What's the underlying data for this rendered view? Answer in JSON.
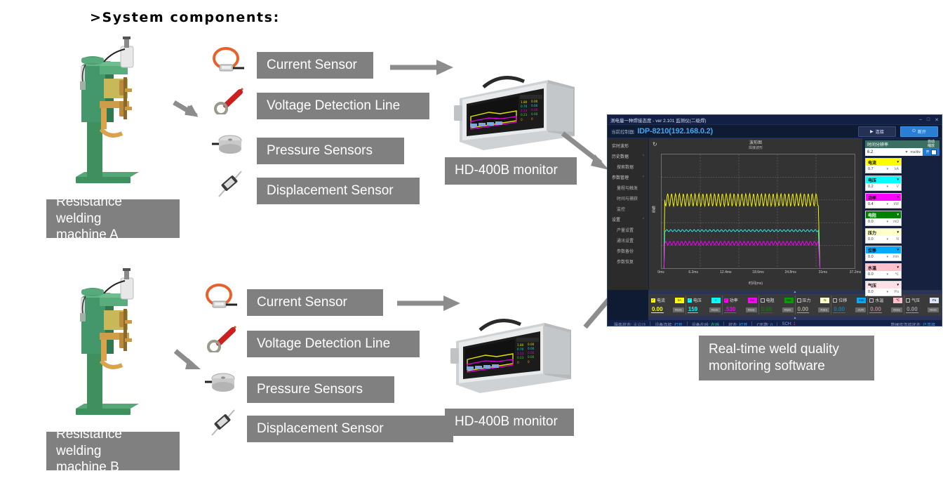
{
  "heading": ">System components:",
  "groups": [
    {
      "machine_label": "Resistance welding\nmachine A",
      "sensors": [
        {
          "label": "Current Sensor",
          "icon": "current-sensor-icon"
        },
        {
          "label": "Voltage Detection Line",
          "icon": "voltage-detection-line-icon"
        },
        {
          "label": "Pressure Sensors",
          "icon": "pressure-sensor-icon"
        },
        {
          "label": "Displacement Sensor",
          "icon": "displacement-sensor-icon"
        }
      ],
      "monitor_label": "HD-400B monitor"
    },
    {
      "machine_label": "Resistance welding\nmachine B",
      "sensors": [
        {
          "label": "Current Sensor",
          "icon": "current-sensor-icon"
        },
        {
          "label": "Voltage Detection Line",
          "icon": "voltage-detection-line-icon"
        },
        {
          "label": "Pressure Sensors",
          "icon": "pressure-sensor-icon"
        },
        {
          "label": "Displacement Sensor",
          "icon": "displacement-sensor-icon"
        }
      ],
      "monitor_label": "HD-400B monitor"
    }
  ],
  "software_caption": "Real-time weld quality\nmonitoring software",
  "software": {
    "title": "测电量一种焊接态度 - ver 2.101 监测仪(二级焊)",
    "window_buttons": [
      "–",
      "□",
      "✕"
    ],
    "controller_label": "当前控制器:",
    "controller_value": "IDP-8210(192.168.0.2)",
    "connect_button": "连接",
    "disconnect_button": "断开",
    "sidebar": [
      {
        "label": "实时波形",
        "sub": false,
        "caret": ""
      },
      {
        "label": "历史数据",
        "sub": false,
        "caret": "⌃"
      },
      {
        "label": "搜索数据",
        "sub": true,
        "caret": ""
      },
      {
        "label": "参数管理",
        "sub": false,
        "caret": "⌃"
      },
      {
        "label": "量程与触发",
        "sub": true,
        "caret": ""
      },
      {
        "label": "时间与捕获",
        "sub": true,
        "caret": ""
      },
      {
        "label": "监控",
        "sub": true,
        "caret": ""
      },
      {
        "label": "设置",
        "sub": false,
        "caret": "⌃"
      },
      {
        "label": "产量设置",
        "sub": true,
        "caret": ""
      },
      {
        "label": "通讯设置",
        "sub": true,
        "caret": ""
      },
      {
        "label": "参数备份",
        "sub": true,
        "caret": ""
      },
      {
        "label": "参数恢复",
        "sub": true,
        "caret": ""
      }
    ],
    "chart_title": "波形图",
    "chart_subtitle": "焊接波形",
    "refresh_icon": "refresh-icon",
    "y_axis_label": "幅值",
    "x_axis_label": "时间(ms)",
    "param_panel": {
      "header_label": "时间分辨率",
      "header_right": "自动\n缩放",
      "value": "6.2",
      "unit": "ms/div",
      "toggle_label": "开",
      "cells": [
        {
          "name": "电流",
          "head_bg": "#ffff00",
          "head_fg": "#000000",
          "value": "0.0",
          "unit": "kA",
          "value_shown": "0.7"
        },
        {
          "name": "电压",
          "head_bg": "#00ffff",
          "head_fg": "#000000",
          "value": "0.2",
          "unit": "V",
          "value_shown": "0.2"
        },
        {
          "name": "功率",
          "head_bg": "#ff00ff",
          "head_fg": "#000000",
          "value": "0.4",
          "unit": "kW",
          "value_shown": "0.4"
        },
        {
          "name": "电阻",
          "head_bg": "#008000",
          "head_fg": "#ffffff",
          "value": "0.0",
          "unit": "mΩ",
          "value_shown": "0.0"
        },
        {
          "name": "压力",
          "head_bg": "#ffffcc",
          "head_fg": "#000000",
          "value": "0.0",
          "unit": "N",
          "value_shown": "0.0"
        },
        {
          "name": "位移",
          "head_bg": "#00aaff",
          "head_fg": "#000000",
          "value": "0.0",
          "unit": "mm",
          "value_shown": "0.0"
        },
        {
          "name": "水温",
          "head_bg": "#ffc0cb",
          "head_fg": "#000000",
          "value": "0.0",
          "unit": "℃",
          "value_shown": "0.0"
        },
        {
          "name": "气压",
          "head_bg": "#ffe0e8",
          "head_fg": "#000000",
          "value": "0.0",
          "unit": "Pa",
          "value_shown": "0.0"
        }
      ]
    },
    "readouts": [
      {
        "name": "电流",
        "checked": true,
        "color": "#ffff00",
        "unit": "kA",
        "value": "0.00",
        "mode": "RMS"
      },
      {
        "name": "电压",
        "checked": true,
        "color": "#00ffff",
        "unit": "V",
        "value": "159",
        "mode": "RMS"
      },
      {
        "name": "功率",
        "checked": true,
        "color": "#ff00ff",
        "unit": "kW",
        "value": ".530",
        "mode": "RMS"
      },
      {
        "name": "电阻",
        "checked": false,
        "color": "#00a000",
        "unit": "mΩ",
        "value": "0.00",
        "mode": "RMS"
      },
      {
        "name": "压力",
        "checked": false,
        "color": "#ffffcc",
        "unit": "N",
        "value": "0.00",
        "mode": "RMS"
      },
      {
        "name": "位移",
        "checked": false,
        "color": "#00aaff",
        "unit": "mm",
        "value": "0.00",
        "mode": "AVR"
      },
      {
        "name": "水温",
        "checked": false,
        "color": "#ffc0cb",
        "unit": "℃",
        "value": "0.00",
        "mode": "RMS"
      },
      {
        "name": "气压",
        "checked": false,
        "color": "#dde6f5",
        "unit": "Pa",
        "value": "0.00",
        "mode": "RMS"
      }
    ],
    "status": [
      {
        "k": "服务状态:",
        "v": "未启动",
        "cls": "grey"
      },
      {
        "k": "设备连接:",
        "v": "打开",
        "cls": ""
      },
      {
        "k": "设备在线:",
        "v": "在线",
        "cls": "green"
      },
      {
        "k": "状态:",
        "v": "打开",
        "cls": ""
      },
      {
        "k": "C形数:",
        "v": "0",
        "cls": ""
      },
      {
        "k": "SCH:",
        "v": "1",
        "cls": "red"
      }
    ],
    "status_right": {
      "k": "数据库连接状态:",
      "v": "已连接",
      "cls": ""
    }
  },
  "chart_data": {
    "type": "line",
    "title": "波形图",
    "subtitle": "焊接波形",
    "xlabel": "时间(ms)",
    "ylabel": "幅值",
    "xlim": [
      0,
      37.2
    ],
    "ylim": [
      0,
      1
    ],
    "grid": true,
    "legend": "none",
    "x_ticks": [
      "0ms",
      "6.2ms",
      "12.4ms",
      "18.6ms",
      "24.8ms",
      "31ms",
      "37.2ms"
    ],
    "series": [
      {
        "name": "电流",
        "color": "#ffff00",
        "plateau": 0.6,
        "rise_ms": 0.6,
        "fall_ms": 30.2,
        "ripple": 0.055
      },
      {
        "name": "电压",
        "color": "#00ffff",
        "plateau": 0.33,
        "rise_ms": 0.6,
        "fall_ms": 30.2,
        "ripple": 0.012
      },
      {
        "name": "功率",
        "color": "#ff00ff",
        "plateau": 0.22,
        "rise_ms": 0.6,
        "fall_ms": 30.2,
        "ripple": 0.022
      }
    ]
  }
}
